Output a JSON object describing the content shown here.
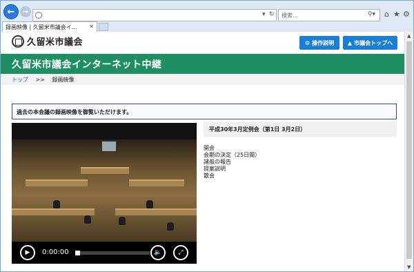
{
  "browser": {
    "search_placeholder": "検索...",
    "tab_title": "録画映像 | 久留米市議会イ..."
  },
  "header": {
    "site_title": "久留米市議会",
    "help_button": "操作説明",
    "top_button": "市議会トップへ"
  },
  "banner": {
    "title": "久留米市議会インターネット中継"
  },
  "breadcrumb": {
    "home": "トップ",
    "separator": ">>",
    "current": "録画映像"
  },
  "notice": "過去の本会議の録画映像を御覧いただけます。",
  "video": {
    "time": "0:00:00",
    "progress": 0
  },
  "session": {
    "title": "平成30年3月定例会（第1日 3月2日）"
  },
  "agenda": [
    "開会",
    "会期の決定（25日間）",
    "諸般の報告",
    "提案説明",
    "散会"
  ],
  "colors": {
    "banner": "#1f8f63",
    "button": "#1a7fd4",
    "link": "#1a6fc4"
  }
}
